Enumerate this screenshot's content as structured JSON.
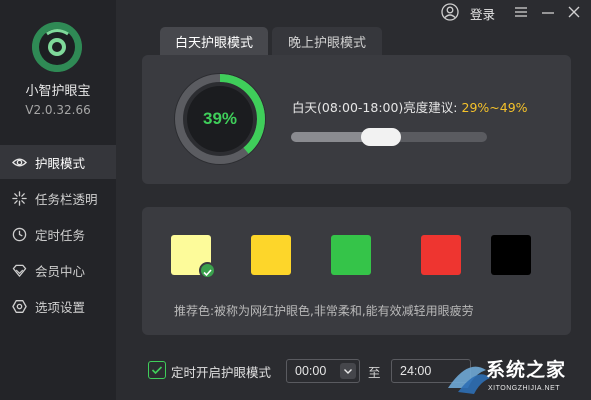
{
  "app": {
    "name": "小智护眼宝",
    "version": "V2.0.32.66",
    "login_label": "登录"
  },
  "sidebar": {
    "items": [
      {
        "label": "护眼模式",
        "icon": "eye-icon",
        "active": true
      },
      {
        "label": "任务栏透明",
        "icon": "sparkle-icon",
        "active": false
      },
      {
        "label": "定时任务",
        "icon": "clock-icon",
        "active": false
      },
      {
        "label": "会员中心",
        "icon": "diamond-icon",
        "active": false
      },
      {
        "label": "选项设置",
        "icon": "hexagon-gear-icon",
        "active": false
      }
    ]
  },
  "tabs": [
    {
      "label": "白天护眼模式",
      "active": true
    },
    {
      "label": "晚上护眼模式",
      "active": false
    }
  ],
  "brightness": {
    "percent": 39,
    "percent_label": "39%",
    "suggest_label": "白天(08:00-18:00)亮度建议:",
    "suggest_range": "29%~49%"
  },
  "colors": {
    "accent_green": "#3fce5a",
    "accent_yellow": "#f5c22a",
    "swatches": [
      {
        "color": "#fdfb9a",
        "selected": true
      },
      {
        "color": "#fdd62a",
        "selected": false
      },
      {
        "color": "#35c449",
        "selected": false
      },
      {
        "color": "#ee3530",
        "selected": false
      },
      {
        "color": "#000000",
        "selected": false
      }
    ],
    "hint": "推荐色:被称为网红护眼色,非常柔和,能有效减轻用眼疲劳"
  },
  "schedule": {
    "enable_label": "定时开启护眼模式",
    "enabled": true,
    "start": "00:00",
    "to_label": "至",
    "end": "24:00"
  },
  "watermark": {
    "text": "系统之家",
    "sub": "XITONGZHIJIA.NET"
  }
}
